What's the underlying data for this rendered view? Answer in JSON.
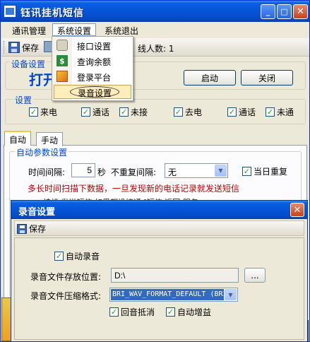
{
  "window": {
    "title": "钰讯挂机短信",
    "minimize_glyph": "_",
    "maximize_glyph": "□",
    "close_glyph": "✕"
  },
  "menubar": {
    "items": [
      {
        "label": "通讯管理"
      },
      {
        "label": "系统设置"
      },
      {
        "label": "系统退出"
      }
    ]
  },
  "toolbar": {
    "save_label": "保存",
    "status_text": "线人数: 1"
  },
  "device_group": {
    "label": "设备设置",
    "open_text": "打开",
    "start_label": "启动",
    "close_label": "关闭"
  },
  "settings_group": {
    "label": "设置",
    "checkboxes": [
      {
        "label": "来电"
      },
      {
        "label": "通话"
      },
      {
        "label": "未接"
      },
      {
        "label": "去电"
      },
      {
        "label": "通话"
      },
      {
        "label": "未通"
      }
    ]
  },
  "tabs": [
    {
      "label": "自动"
    },
    {
      "label": "手动"
    }
  ],
  "auto_params": {
    "label": "自动参数设置",
    "interval_label": "时间间隔:",
    "interval_value": "5",
    "seconds_label": "秒",
    "no_repeat_label": "不重复间隔:",
    "no_repeat_value": "无",
    "same_day_label": "当日重复",
    "warning": "多长时间扫描下数据，一旦发现新的电话记录就发送短信",
    "partial_text": "挂机  发送短信  如果都没接通 [短信  返回  服务"
  },
  "dropdown_menu": {
    "items": [
      {
        "label": "接口设置",
        "icon": "gear-icon"
      },
      {
        "label": "查询余额",
        "icon": "dollar-icon"
      },
      {
        "label": "登录平台",
        "icon": "platform-icon"
      },
      {
        "label": "录音设置",
        "icon": ""
      }
    ]
  },
  "dialog": {
    "title": "录音设置",
    "close_glyph": "✕",
    "save_label": "保存",
    "auto_record_label": "自动录音",
    "path_label": "录音文件存放位置:",
    "path_value": "D:\\",
    "browse_label": "...",
    "format_label": "录音文件压缩格式:",
    "format_value": "BRI_WAV_FORMAT_DEFAULT (BRI",
    "echo_cancel_label": "回音抵消",
    "auto_gain_label": "自动增益"
  },
  "colors": {
    "title_blue": "#0554d8",
    "group_label_blue": "#0046d5",
    "warning_red": "#c00000",
    "menu_highlight": "#ffeebb",
    "check_green": "#21a121"
  }
}
